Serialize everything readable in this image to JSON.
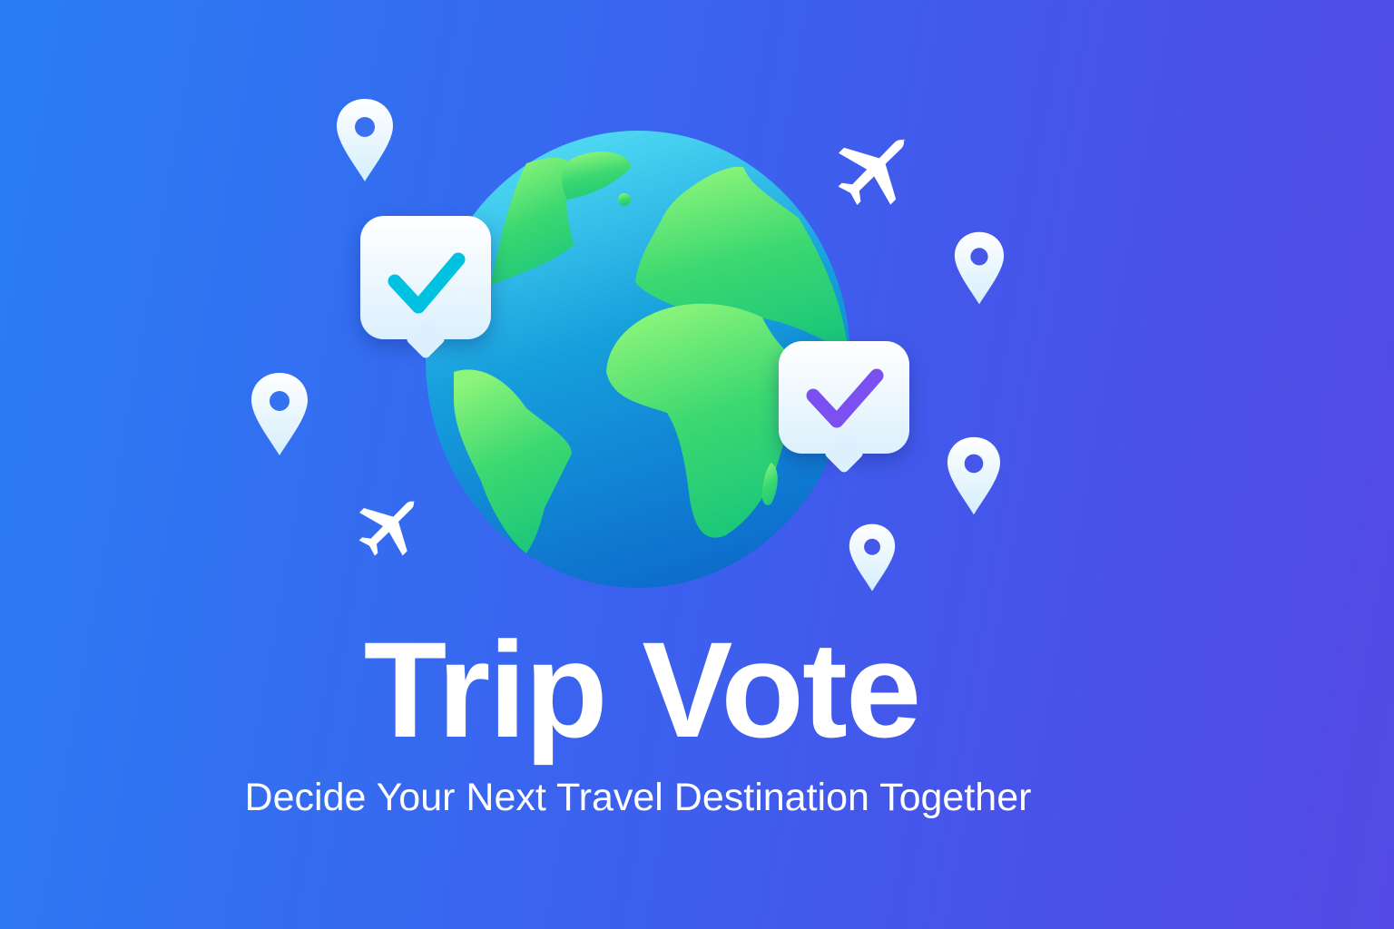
{
  "title": "Trip Vote",
  "subtitle": "Decide Your Next Travel Destination Together",
  "icons": [
    "globe-icon",
    "location-pin-icon",
    "airplane-icon",
    "check-bubble-icon"
  ],
  "colors": {
    "background_start": "#2a7df3",
    "background_end": "#5549e6",
    "ocean": "#1a9ee0",
    "land": "#3ed66f",
    "check_cyan": "#00c2e0",
    "check_purple": "#7b4ff0"
  }
}
